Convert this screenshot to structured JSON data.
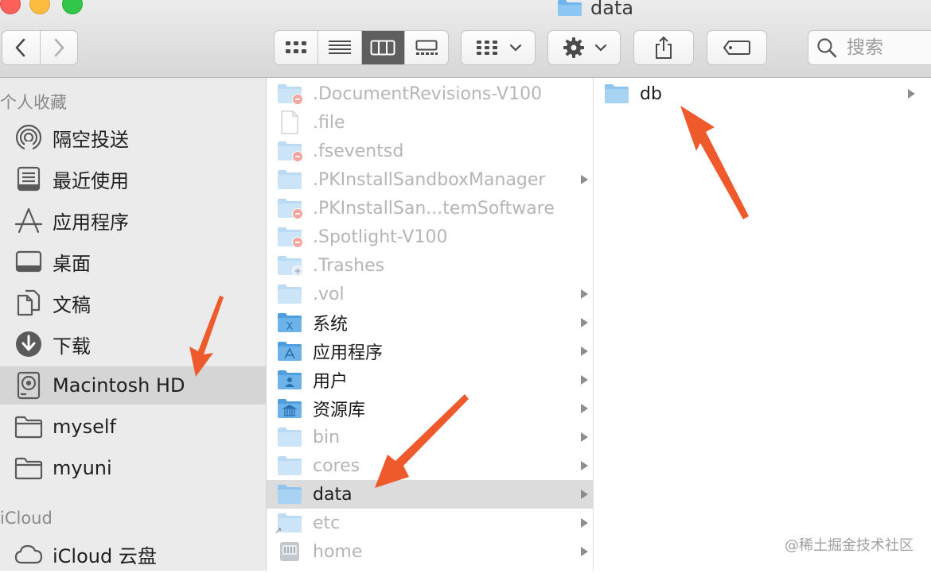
{
  "window": {
    "title": "data"
  },
  "toolbar": {
    "search_placeholder": "搜索",
    "view_modes": [
      "icon",
      "list",
      "column",
      "gallery"
    ],
    "active_view": "column"
  },
  "sidebar": {
    "favorites_header": "个人收藏",
    "items": [
      {
        "label": "隔空投送",
        "icon": "airdrop-icon"
      },
      {
        "label": "最近使用",
        "icon": "recents-icon"
      },
      {
        "label": "应用程序",
        "icon": "applications-icon"
      },
      {
        "label": "桌面",
        "icon": "desktop-icon"
      },
      {
        "label": "文稿",
        "icon": "documents-icon"
      },
      {
        "label": "下载",
        "icon": "downloads-icon"
      },
      {
        "label": "Macintosh HD",
        "icon": "hard-drive-icon",
        "selected": true
      },
      {
        "label": "myself",
        "icon": "folder-icon"
      },
      {
        "label": "myuni",
        "icon": "folder-icon"
      }
    ],
    "icloud_header": "iCloud",
    "icloud_items": [
      {
        "label": "iCloud 云盘",
        "icon": "cloud-icon"
      }
    ]
  },
  "column1": {
    "items": [
      {
        "label": ".DocumentRevisions-V100",
        "icon": "folder-restricted-icon",
        "dim": true,
        "arrow": false
      },
      {
        "label": ".file",
        "icon": "document-icon",
        "dim": true,
        "arrow": false
      },
      {
        "label": ".fseventsd",
        "icon": "folder-restricted-icon",
        "dim": true,
        "arrow": false
      },
      {
        "label": ".PKInstallSandboxManager",
        "icon": "folder-icon",
        "dim": true,
        "arrow": true
      },
      {
        "label": ".PKInstallSan...temSoftware",
        "icon": "folder-restricted-icon",
        "dim": true,
        "arrow": false
      },
      {
        "label": ".Spotlight-V100",
        "icon": "folder-restricted-icon",
        "dim": true,
        "arrow": false
      },
      {
        "label": ".Trashes",
        "icon": "folder-dropbox-icon",
        "dim": true,
        "arrow": false
      },
      {
        "label": ".vol",
        "icon": "folder-icon",
        "dim": true,
        "arrow": true
      },
      {
        "label": "系统",
        "icon": "system-folder-icon",
        "dim": false,
        "arrow": true
      },
      {
        "label": "应用程序",
        "icon": "applications-folder-icon",
        "dim": false,
        "arrow": true
      },
      {
        "label": "用户",
        "icon": "users-folder-icon",
        "dim": false,
        "arrow": true
      },
      {
        "label": "资源库",
        "icon": "library-folder-icon",
        "dim": false,
        "arrow": true
      },
      {
        "label": "bin",
        "icon": "folder-icon",
        "dim": true,
        "arrow": true
      },
      {
        "label": "cores",
        "icon": "folder-icon",
        "dim": true,
        "arrow": true
      },
      {
        "label": "data",
        "icon": "folder-icon",
        "dim": false,
        "arrow": true,
        "selected": true
      },
      {
        "label": "etc",
        "icon": "folder-alias-icon",
        "dim": true,
        "arrow": true
      },
      {
        "label": "home",
        "icon": "server-icon",
        "dim": true,
        "arrow": true
      }
    ]
  },
  "column2": {
    "items": [
      {
        "label": "db",
        "icon": "folder-icon",
        "dim": false,
        "arrow": true
      }
    ]
  },
  "watermark": "@稀土掘金技术社区",
  "colors": {
    "folder_light": "#a9d3f2",
    "folder_dark": "#5aa8e6",
    "annotation_arrow": "#ee5a2b",
    "selection_gray": "#d5d5d5"
  }
}
